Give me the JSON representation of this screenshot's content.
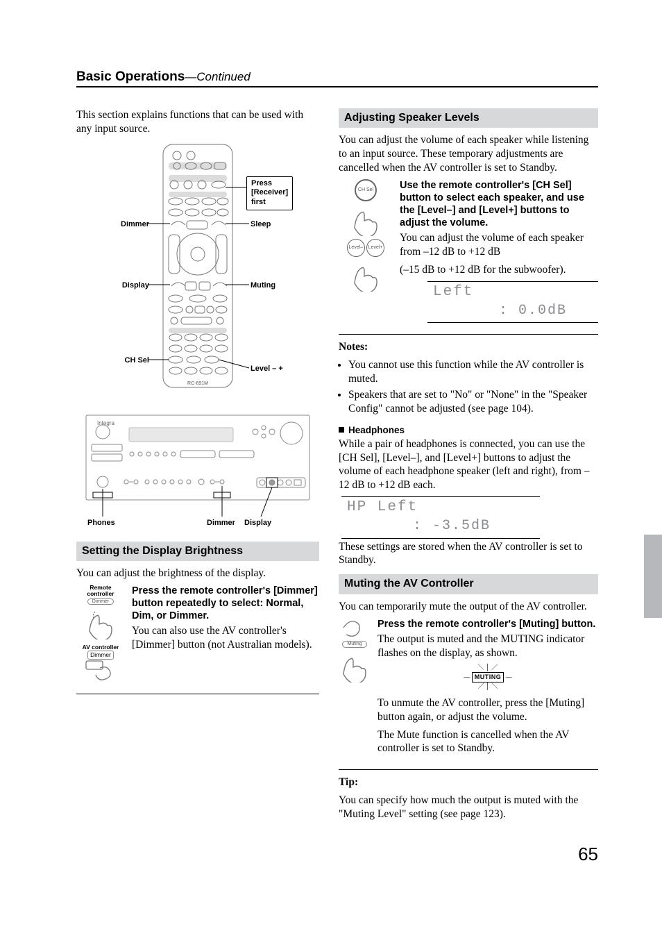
{
  "chapter": {
    "title": "Basic Operations",
    "continued": "—Continued"
  },
  "intro": "This section explains functions that can be used with any input source.",
  "remote_labels": {
    "press_receiver": "Press\n[Receiver]\nfirst",
    "dimmer": "Dimmer",
    "sleep": "Sleep",
    "display": "Display",
    "muting": "Muting",
    "ch_sel": "CH Sel",
    "level": "Level – +",
    "model": "RC-691M"
  },
  "panel": {
    "phones": "Phones",
    "dimmer": "Dimmer",
    "display": "Display",
    "brand": "Integra"
  },
  "sect1": {
    "title": "Setting the Display Brightness",
    "lead": "You can adjust the brightness of the display.",
    "step_label_rc": "Remote controller",
    "step_btn_rc": "Dimmer",
    "step_label_av": "AV controller",
    "step_btn_av": "Dimmer",
    "instr_bold": "Press the remote controller's [Dimmer] button repeatedly to select: Normal, Dim, or Dimmer.",
    "instr_rest": "You can also use the AV controller's [Dimmer] button (not Australian models)."
  },
  "sect2": {
    "title": "Adjusting Speaker Levels",
    "lead": "You can adjust the volume of each speaker while listening to an input source. These temporary adjustments are cancelled when the AV controller is set to Standby.",
    "btn_chsel": "CH Sel",
    "btn_lminus": "Level–",
    "btn_lplus": "Level+",
    "instr_bold": "Use the remote controller's [CH Sel] button to select each speaker, and use the [Level–] and [Level+] buttons to adjust the volume.",
    "instr_rest1": "You can adjust the volume of each speaker from –12 dB to +12 dB",
    "instr_rest2": "(–15 dB to +12 dB for the subwoofer).",
    "lcd_line1": "Left",
    "lcd_line2": ":   0.0dB",
    "notes_head": "Notes:",
    "note1": "You cannot use this function while the AV controller is muted.",
    "note2": "Speakers that are set to \"No\" or \"None\" in the \"Speaker Config\" cannot be adjusted (see page 104).",
    "hp_head": "Headphones",
    "hp_para": "While a pair of headphones is connected, you can use the [CH Sel], [Level–], and [Level+] buttons to adjust the volume of each headphone speaker (left and right), from –12 dB to +12 dB each.",
    "hp_lcd1": "HP Left",
    "hp_lcd2": ":  -3.5dB",
    "hp_tail": "These settings are stored when the AV controller is set to Standby."
  },
  "sect3": {
    "title": "Muting the AV Controller",
    "lead": "You can temporarily mute the output of the AV controller.",
    "btn": "Muting",
    "instr_bold": "Press the remote controller's [Muting] button.",
    "instr_rest": "The output is muted and the MUTING indicator flashes on the display, as shown.",
    "indicator": "MUTING",
    "tail1": "To unmute the AV controller, press the [Muting] button again, or adjust the volume.",
    "tail2": "The Mute function is cancelled when the AV controller is set to Standby.",
    "tip_head": "Tip:",
    "tip_body": "You can specify how much the output is muted with the \"Muting Level\" setting (see page 123)."
  },
  "page_number": "65"
}
